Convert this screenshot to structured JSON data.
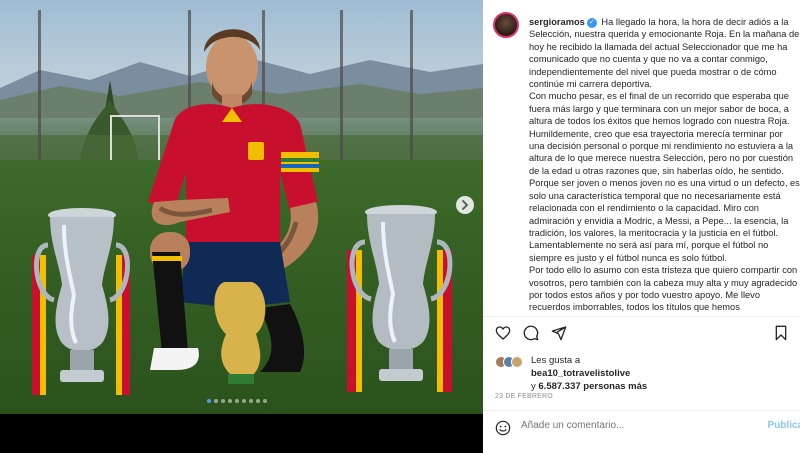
{
  "post": {
    "username": "sergioramos",
    "caption_paragraphs": [
      "Ha llegado la hora, la hora de decir adiós a la Selección, nuestra querida y emocionante Roja. En la mañana de hoy he recibido la llamada del actual Seleccionador que me ha comunicado que no cuenta y que no va a contar conmigo, independientemente del nivel que pueda mostrar o de cómo continúe mi carrera deportiva.",
      "Con mucho pesar, es el final de un recorrido que esperaba que fuera más largo y que terminara con un mejor sabor de boca, a altura de todos los éxitos que hemos logrado con nuestra Roja. Humildemente, creo que esa trayectoria merecía terminar por una decisión personal o porque mi rendimiento no estuviera a la altura de lo que merece nuestra Selección, pero no por cuestión de la edad u otras razones que, sin haberlas oído, he sentido. Porque ser joven o menos joven no es una virtud o un defecto, es solo una característica temporal que no necesariamente está relacionada con el rendimiento o la capacidad. Miro con admiración y envidia a Modric, a Messi, a Pepe... la esencia, la tradición, los valores, la meritocracia y la justicia en el fútbol. Lamentablemente no será así para mí, porque el fútbol no siempre es justo y el fútbol nunca es solo fútbol.",
      "Por todo ello lo asumo con esta tristeza que quiero compartir con vosotros, pero también con la cabeza muy alta y muy agradecido por todos estos años y por todo vuestro apoyo. Me llevo recuerdos imborrables, todos los títulos que hemos"
    ],
    "likes_prefix": "Les gusta a",
    "likes_user": "bea10_totravelistolive",
    "likes_connector": "y",
    "likes_count": "6.587.337",
    "likes_suffix": "personas más",
    "date": "23 DE FEBRERO",
    "comment_placeholder": "Añade un comentario...",
    "post_button": "Publicar"
  },
  "carousel": {
    "total_dots": 9,
    "active_dot": 0,
    "next_icon": "chevron-right-icon"
  },
  "colors": {
    "verified": "#3897f0",
    "active_dot": "#4a9ff5",
    "post_button": "#8ec6f8",
    "jersey": "#c8102e"
  }
}
